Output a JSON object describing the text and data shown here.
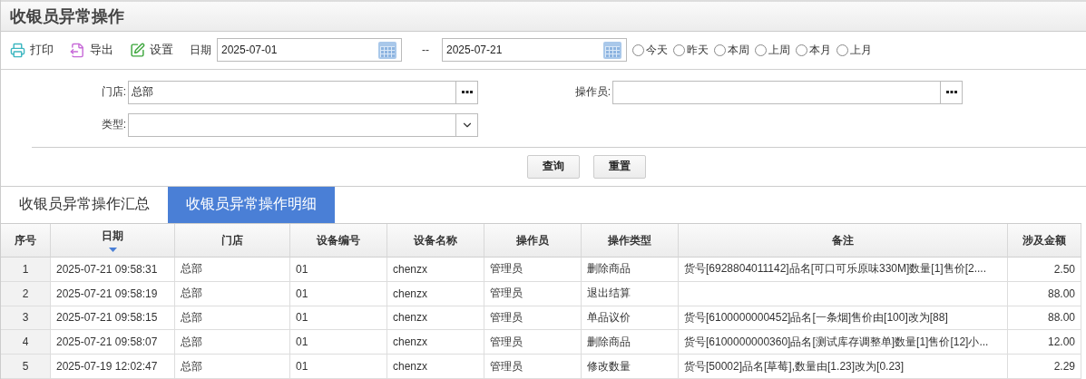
{
  "title": "收银员异常操作",
  "toolbar": {
    "buttons": [
      {
        "kind": "print",
        "label": "打印"
      },
      {
        "kind": "export",
        "label": "导出"
      },
      {
        "kind": "settings",
        "label": "设置"
      }
    ],
    "date_label": "日期",
    "date_from": "2025-07-01",
    "separator": "--",
    "date_to": "2025-07-21",
    "ranges": [
      {
        "label": "今天",
        "selected": false
      },
      {
        "label": "昨天",
        "selected": false
      },
      {
        "label": "本周",
        "selected": false
      },
      {
        "label": "上周",
        "selected": false
      },
      {
        "label": "本月",
        "selected": false
      },
      {
        "label": "上月",
        "selected": false
      }
    ]
  },
  "filters": [
    {
      "label": "门店:",
      "kind": "picker",
      "value": "总部"
    },
    {
      "label": "操作员:",
      "kind": "picker"
    },
    {
      "label": "类型:",
      "kind": "select"
    }
  ],
  "actions": [
    "查询",
    "重置"
  ],
  "tabs": [
    {
      "label": "收银员异常操作汇总",
      "selected": false
    },
    {
      "label": "收银员异常操作明细",
      "selected": true
    }
  ],
  "table": {
    "columns": [
      {
        "label": "序号",
        "sorted": false
      },
      {
        "label": "日期",
        "sorted": true
      },
      {
        "label": "门店",
        "sorted": false
      },
      {
        "label": "设备编号",
        "sorted": false
      },
      {
        "label": "设备名称",
        "sorted": false
      },
      {
        "label": "操作员",
        "sorted": false
      },
      {
        "label": "操作类型",
        "sorted": false
      },
      {
        "label": "备注",
        "sorted": false
      },
      {
        "label": "涉及金额",
        "sorted": false
      }
    ],
    "rows": [
      [
        "1",
        "2025-07-21 09:58:31",
        "总部",
        "01",
        "chenzx",
        "管理员",
        "删除商品",
        "货号[6928804011142]品名[可口可乐原味330M]数量[1]售价[2....",
        "2.50"
      ],
      [
        "2",
        "2025-07-21 09:58:19",
        "总部",
        "01",
        "chenzx",
        "管理员",
        "退出结算",
        null,
        "88.00"
      ],
      [
        "3",
        "2025-07-21 09:58:15",
        "总部",
        "01",
        "chenzx",
        "管理员",
        "单品议价",
        "货号[6100000000452]品名[一条烟]售价由[100]改为[88]",
        "88.00"
      ],
      [
        "4",
        "2025-07-21 09:58:07",
        "总部",
        "01",
        "chenzx",
        "管理员",
        "删除商品",
        "货号[6100000000360]品名[测试库存调整单]数量[1]售价[12]小...",
        "12.00"
      ],
      [
        "5",
        "2025-07-19 12:02:47",
        "总部",
        "01",
        "chenzx",
        "管理员",
        "修改数量",
        "货号[50002]品名[草莓],数量由[1.23]改为[0.23]",
        "2.29"
      ]
    ]
  }
}
